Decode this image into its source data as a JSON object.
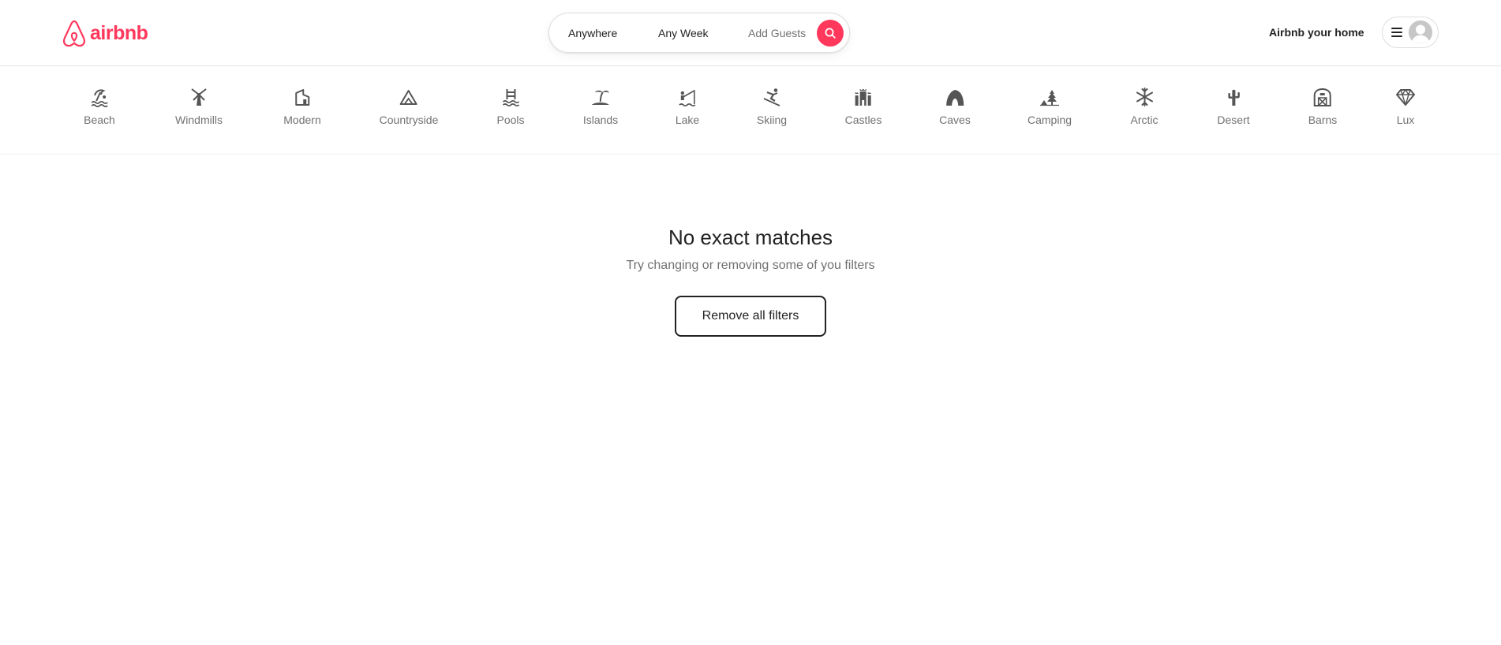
{
  "brand": {
    "name": "airbnb",
    "color": "#ff385c"
  },
  "search": {
    "location": "Anywhere",
    "dates": "Any Week",
    "guests": "Add Guests",
    "button_icon": "search-icon"
  },
  "header": {
    "host_link": "Airbnb your home",
    "menu_icon": "hamburger-menu-icon",
    "avatar_icon": "user-avatar-icon"
  },
  "categories": [
    {
      "label": "Beach",
      "icon": "beach-umbrella-icon"
    },
    {
      "label": "Windmills",
      "icon": "windmill-icon"
    },
    {
      "label": "Modern",
      "icon": "modern-house-icon"
    },
    {
      "label": "Countryside",
      "icon": "mountain-icon"
    },
    {
      "label": "Pools",
      "icon": "pool-ladder-icon"
    },
    {
      "label": "Islands",
      "icon": "palm-island-icon"
    },
    {
      "label": "Lake",
      "icon": "fishing-icon"
    },
    {
      "label": "Skiing",
      "icon": "skier-icon"
    },
    {
      "label": "Castles",
      "icon": "castle-icon"
    },
    {
      "label": "Caves",
      "icon": "cave-icon"
    },
    {
      "label": "Camping",
      "icon": "tent-tree-icon"
    },
    {
      "label": "Arctic",
      "icon": "snowflake-icon"
    },
    {
      "label": "Desert",
      "icon": "cactus-icon"
    },
    {
      "label": "Barns",
      "icon": "barn-icon"
    },
    {
      "label": "Lux",
      "icon": "diamond-icon"
    }
  ],
  "empty_state": {
    "title": "No exact matches",
    "subtitle": "Try changing or removing some of you filters",
    "button": "Remove all filters"
  }
}
